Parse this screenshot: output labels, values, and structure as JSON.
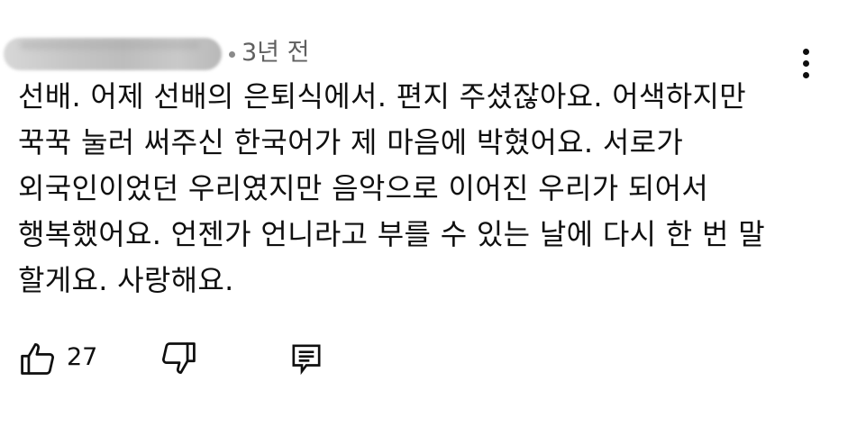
{
  "comment": {
    "time": "3년 전",
    "text": "선배. 어제 선배의 은퇴식에서. 편지 주셨잖아요. 어색하지만\n꾹꾹 눌러 써주신 한국어가 제 마음에 박혔어요. 서로가\n외국인이었던 우리였지만 음악으로 이어진 우리가 되어서\n행복했어요. 언젠가 언니라고 부를 수 있는 날에 다시 한 번 말\n할게요. 사랑해요.",
    "like_count": "27"
  },
  "icons": {
    "menu": "more-vert-icon",
    "like": "thumb-up-icon",
    "dislike": "thumb-down-icon",
    "reply": "reply-comment-icon"
  },
  "colors": {
    "text": "#0f0f0f",
    "secondary_text": "#606060"
  }
}
